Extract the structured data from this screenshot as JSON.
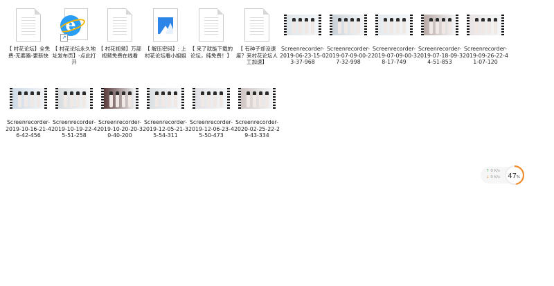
{
  "files": [
    {
      "type": "text",
      "label": "【 村花论坛】全免费-无套路-更新快",
      "icon": "text-file-icon"
    },
    {
      "type": "ie",
      "label": "【 村花论坛永久地址发布页】-点此打开",
      "icon": "internet-shortcut-icon"
    },
    {
      "type": "text",
      "label": "【 村花视频】万部视频免费在线看",
      "icon": "text-file-icon"
    },
    {
      "type": "image",
      "label": "【 解压密码】: 上村花论坛看小姐姐",
      "icon": "image-file-icon"
    },
    {
      "type": "text",
      "label": "【 来了就能下载的论坛，纯免费！】",
      "icon": "text-file-icon"
    },
    {
      "type": "text",
      "label": "【 有种子却没速度？来村花论坛人工加速】",
      "icon": "text-file-icon"
    },
    {
      "type": "video",
      "label": "Screenrecorder-2019-06-23-15-03-37-968",
      "icon": "video-thumbnail-icon"
    },
    {
      "type": "video",
      "label": "Screenrecorder-2019-07-09-00-27-32-998",
      "icon": "video-thumbnail-icon"
    },
    {
      "type": "video",
      "label": "Screenrecorder-2019-07-09-00-38-17-749",
      "icon": "video-thumbnail-icon"
    },
    {
      "type": "video",
      "label": "Screenrecorder-2019-07-18-09-34-51-853",
      "icon": "video-thumbnail-icon"
    },
    {
      "type": "video",
      "label": "Screenrecorder-2019-09-26-22-41-07-120",
      "icon": "video-thumbnail-icon"
    },
    {
      "type": "video",
      "label": "Screenrecorder-2019-10-16-21-46-42-456",
      "icon": "video-thumbnail-icon"
    },
    {
      "type": "video",
      "label": "Screenrecorder-2019-10-19-22-45-51-258",
      "icon": "video-thumbnail-icon"
    },
    {
      "type": "video",
      "label": "Screenrecorder-2019-10-20-20-30-40-200",
      "icon": "video-thumbnail-icon"
    },
    {
      "type": "video",
      "label": "Screenrecorder-2019-12-05-21-35-54-311",
      "icon": "video-thumbnail-icon"
    },
    {
      "type": "video",
      "label": "Screenrecorder-2019-12-06-23-45-50-473",
      "icon": "video-thumbnail-icon"
    },
    {
      "type": "video",
      "label": "Screenrecorder-2020-02-25-22-29-43-334",
      "icon": "video-thumbnail-icon"
    }
  ],
  "widget": {
    "upload_speed": "0",
    "upload_unit": "K/s",
    "download_speed": "0",
    "download_unit": "K/s",
    "percent": "47",
    "percent_sign": "%",
    "percent_value": 0.47,
    "accent_color": "#f08c2c"
  }
}
